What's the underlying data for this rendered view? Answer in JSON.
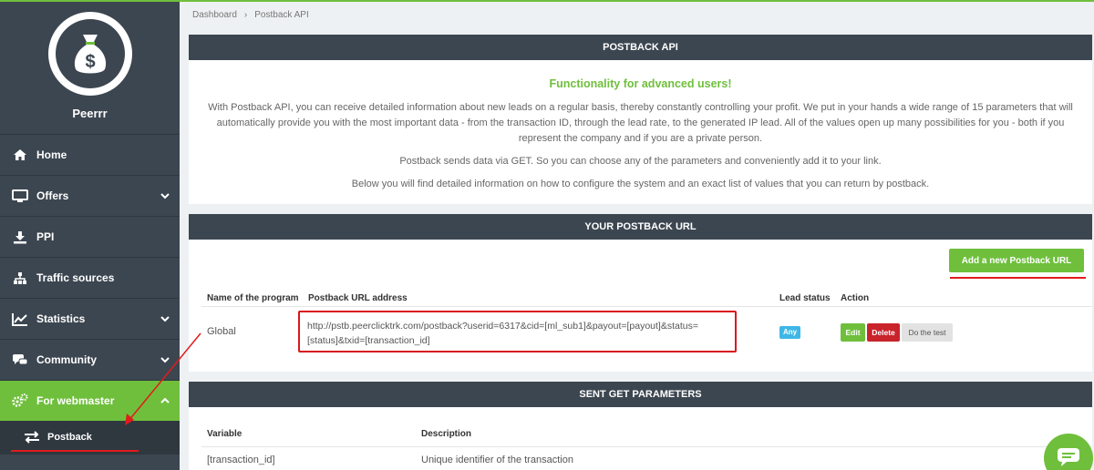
{
  "brand": {
    "name": "Peerrr",
    "logo_icon": "money-bag-icon"
  },
  "breadcrumb": {
    "home": "Dashboard",
    "separator": "›",
    "current": "Postback API"
  },
  "sidebar": {
    "items": [
      {
        "label": "Home",
        "icon": "home-icon"
      },
      {
        "label": "Offers",
        "icon": "monitor-icon"
      },
      {
        "label": "PPI",
        "icon": "download-icon"
      },
      {
        "label": "Traffic sources",
        "icon": "sitemap-icon"
      },
      {
        "label": "Statistics",
        "icon": "chart-line-icon"
      },
      {
        "label": "Community",
        "icon": "chat-icon"
      },
      {
        "label": "For webmaster",
        "icon": "gears-icon"
      }
    ],
    "sub_items": [
      {
        "label": "Postback",
        "icon": "exchange-icon"
      }
    ]
  },
  "postback_api": {
    "header": "POSTBACK API",
    "tagline": "Functionality for advanced users!",
    "paragraph1": "With Postback API, you can receive detailed information about new leads on a regular basis, thereby constantly controlling your profit. We put in your hands a wide range of 15 parameters that will automatically provide you with the most important data - from the transaction ID, through the lead rate, to the generated IP lead. All of the values open up many possibilities for you - both if you represent the company and if you are a private person.",
    "paragraph2": "Postback sends data via GET. So you can choose any of the parameters and conveniently add it to your link.",
    "paragraph3": "Below you will find detailed information on how to configure the system and an exact list of values that you can return by postback."
  },
  "your_postback": {
    "header": "YOUR POSTBACK URL",
    "add_button": "Add a new Postback URL",
    "columns": {
      "program": "Name of the program",
      "url": "Postback URL address",
      "status": "Lead status",
      "action": "Action"
    },
    "row": {
      "program": "Global",
      "url": "http://pstb.peerclicktrk.com/postback?userid=6317&cid=[ml_sub1]&payout=[payout]&status=[status]&txid=[transaction_id]",
      "status_badge": "Any",
      "edit": "Edit",
      "delete": "Delete",
      "test": "Do the test"
    }
  },
  "sent_get": {
    "header": "SENT GET PARAMETERS",
    "columns": {
      "variable": "Variable",
      "description": "Description"
    },
    "rows": [
      {
        "variable": "[transaction_id]",
        "description": "Unique identifier of the transaction"
      }
    ]
  },
  "colors": {
    "accent_green": "#6fbf3c",
    "sidebar_bg": "#3c4650",
    "header_bg": "#3c4650",
    "annotation_red": "#e21b1b",
    "badge_blue": "#3fb7e6",
    "delete_red": "#c9232b"
  }
}
